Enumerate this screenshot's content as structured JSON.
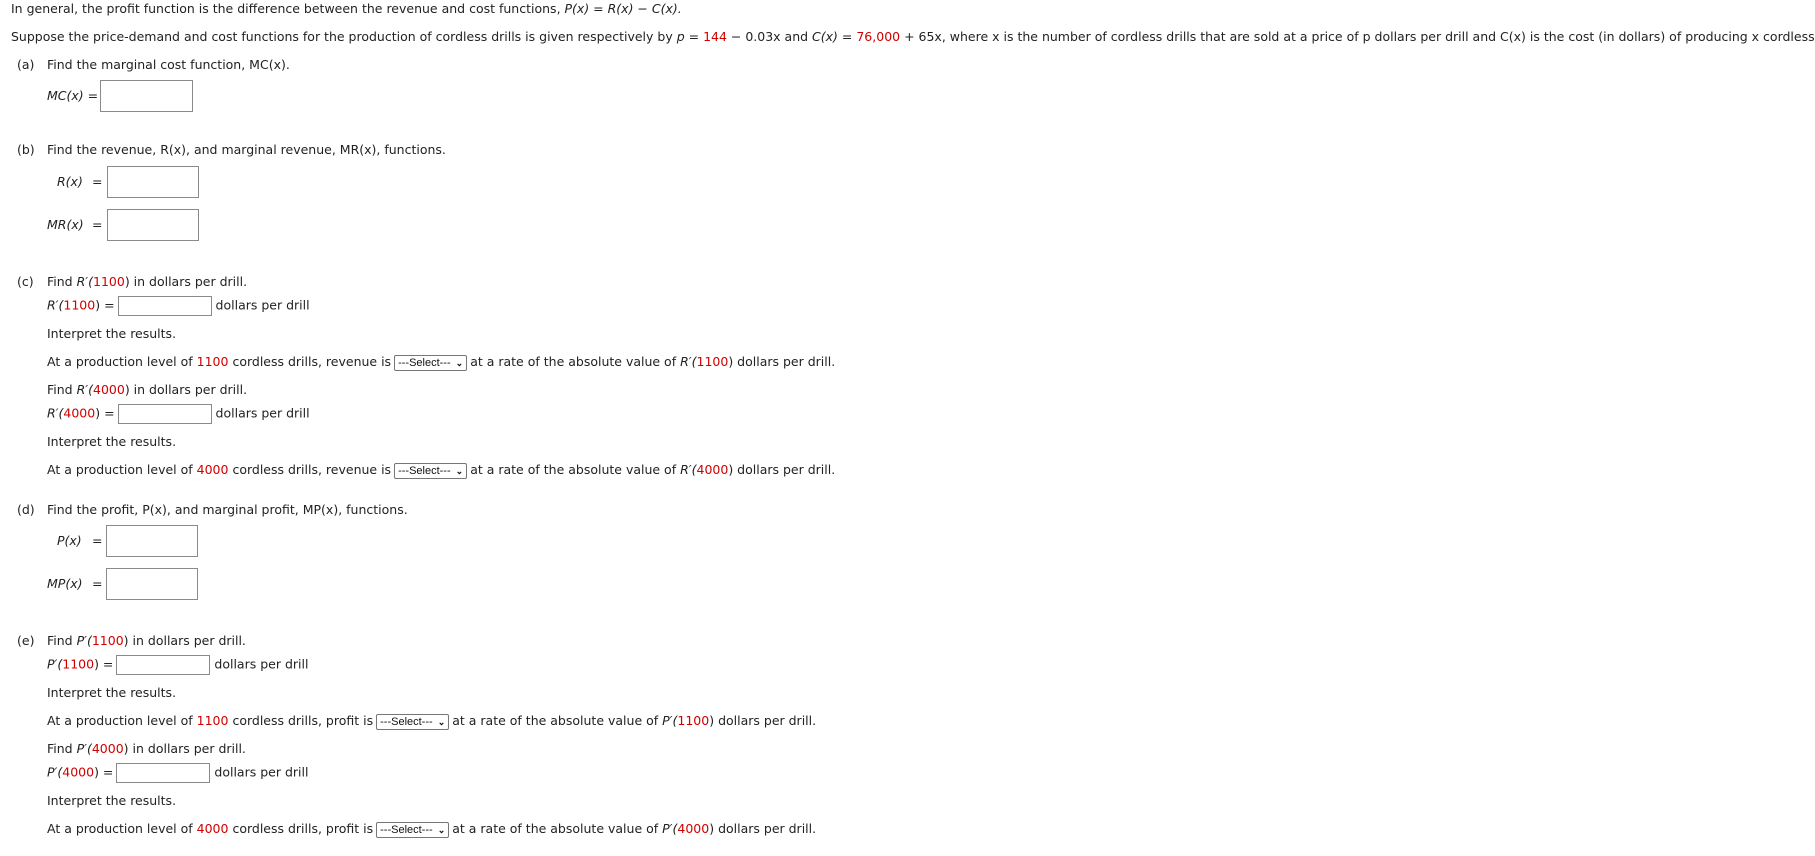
{
  "intro": {
    "line1_text": "In general, the profit function is the difference between the revenue and cost functions, ",
    "line1_formula": "P(x) = R(x) − C(x).",
    "line2_a": "Suppose the price-demand and cost functions for the production of cordless drills is given respectively by ",
    "p_var": "p",
    "eq": " = ",
    "p_const": "144",
    "p_rest": " − 0.03x and ",
    "c_fn": "C(x)",
    "c_const": "76,000",
    "c_rest": " + 65x, where x is the number of cordless drills that are sold at a price of p dollars per drill and C(x) is the cost (in dollars) of producing x cordless drills."
  },
  "a": {
    "label": "(a)",
    "prompt": "Find the marginal cost function, MC(x).",
    "field_label": "MC(x) =",
    "value": ""
  },
  "b": {
    "label": "(b)",
    "prompt": "Find the revenue, R(x), and marginal revenue, MR(x), functions.",
    "r_label": "R(x)",
    "mr_label": "MR(x)",
    "equals": "="
  },
  "c": {
    "label": "(c)",
    "items": [
      {
        "find_pre": "Find ",
        "fn": "R′(",
        "x": "1100",
        "find_post": ") in dollars per drill.",
        "eq": ") =",
        "units": "dollars per drill",
        "interpret": "Interpret the results.",
        "at_pre": "At a production level of ",
        "at_mid": " cordless drills, revenue is",
        "select": "---Select---",
        "rate_pre": "at a rate of the absolute value of ",
        "rate_post": ") dollars per drill."
      },
      {
        "find_pre": "Find ",
        "fn": "R′(",
        "x": "4000",
        "find_post": ") in dollars per drill.",
        "eq": ") =",
        "units": "dollars per drill",
        "interpret": "Interpret the results.",
        "at_pre": "At a production level of ",
        "at_mid": " cordless drills, revenue is",
        "select": "---Select---",
        "rate_pre": "at a rate of the absolute value of ",
        "rate_post": ") dollars per drill."
      }
    ]
  },
  "d": {
    "label": "(d)",
    "prompt": "Find the profit, P(x), and marginal profit, MP(x), functions.",
    "p_label": "P(x)",
    "mp_label": "MP(x)",
    "equals": "="
  },
  "e": {
    "label": "(e)",
    "items": [
      {
        "find_pre": "Find ",
        "fn": "P′(",
        "x": "1100",
        "find_post": ") in dollars per drill.",
        "eq": ") =",
        "units": "dollars per drill",
        "interpret": "Interpret the results.",
        "at_pre": "At a production level of ",
        "at_mid": " cordless drills, profit is",
        "select": "---Select---",
        "rate_pre": "at a rate of the absolute value of ",
        "rate_post": ") dollars per drill."
      },
      {
        "find_pre": "Find ",
        "fn": "P′(",
        "x": "4000",
        "find_post": ") in dollars per drill.",
        "eq": ") =",
        "units": "dollars per drill",
        "interpret": "Interpret the results.",
        "at_pre": "At a production level of ",
        "at_mid": " cordless drills, profit is",
        "select": "---Select---",
        "rate_pre": "at a rate of the absolute value of ",
        "rate_post": ") dollars per drill."
      }
    ]
  },
  "colors": {
    "highlight": "#d10000",
    "text": "#222222"
  }
}
